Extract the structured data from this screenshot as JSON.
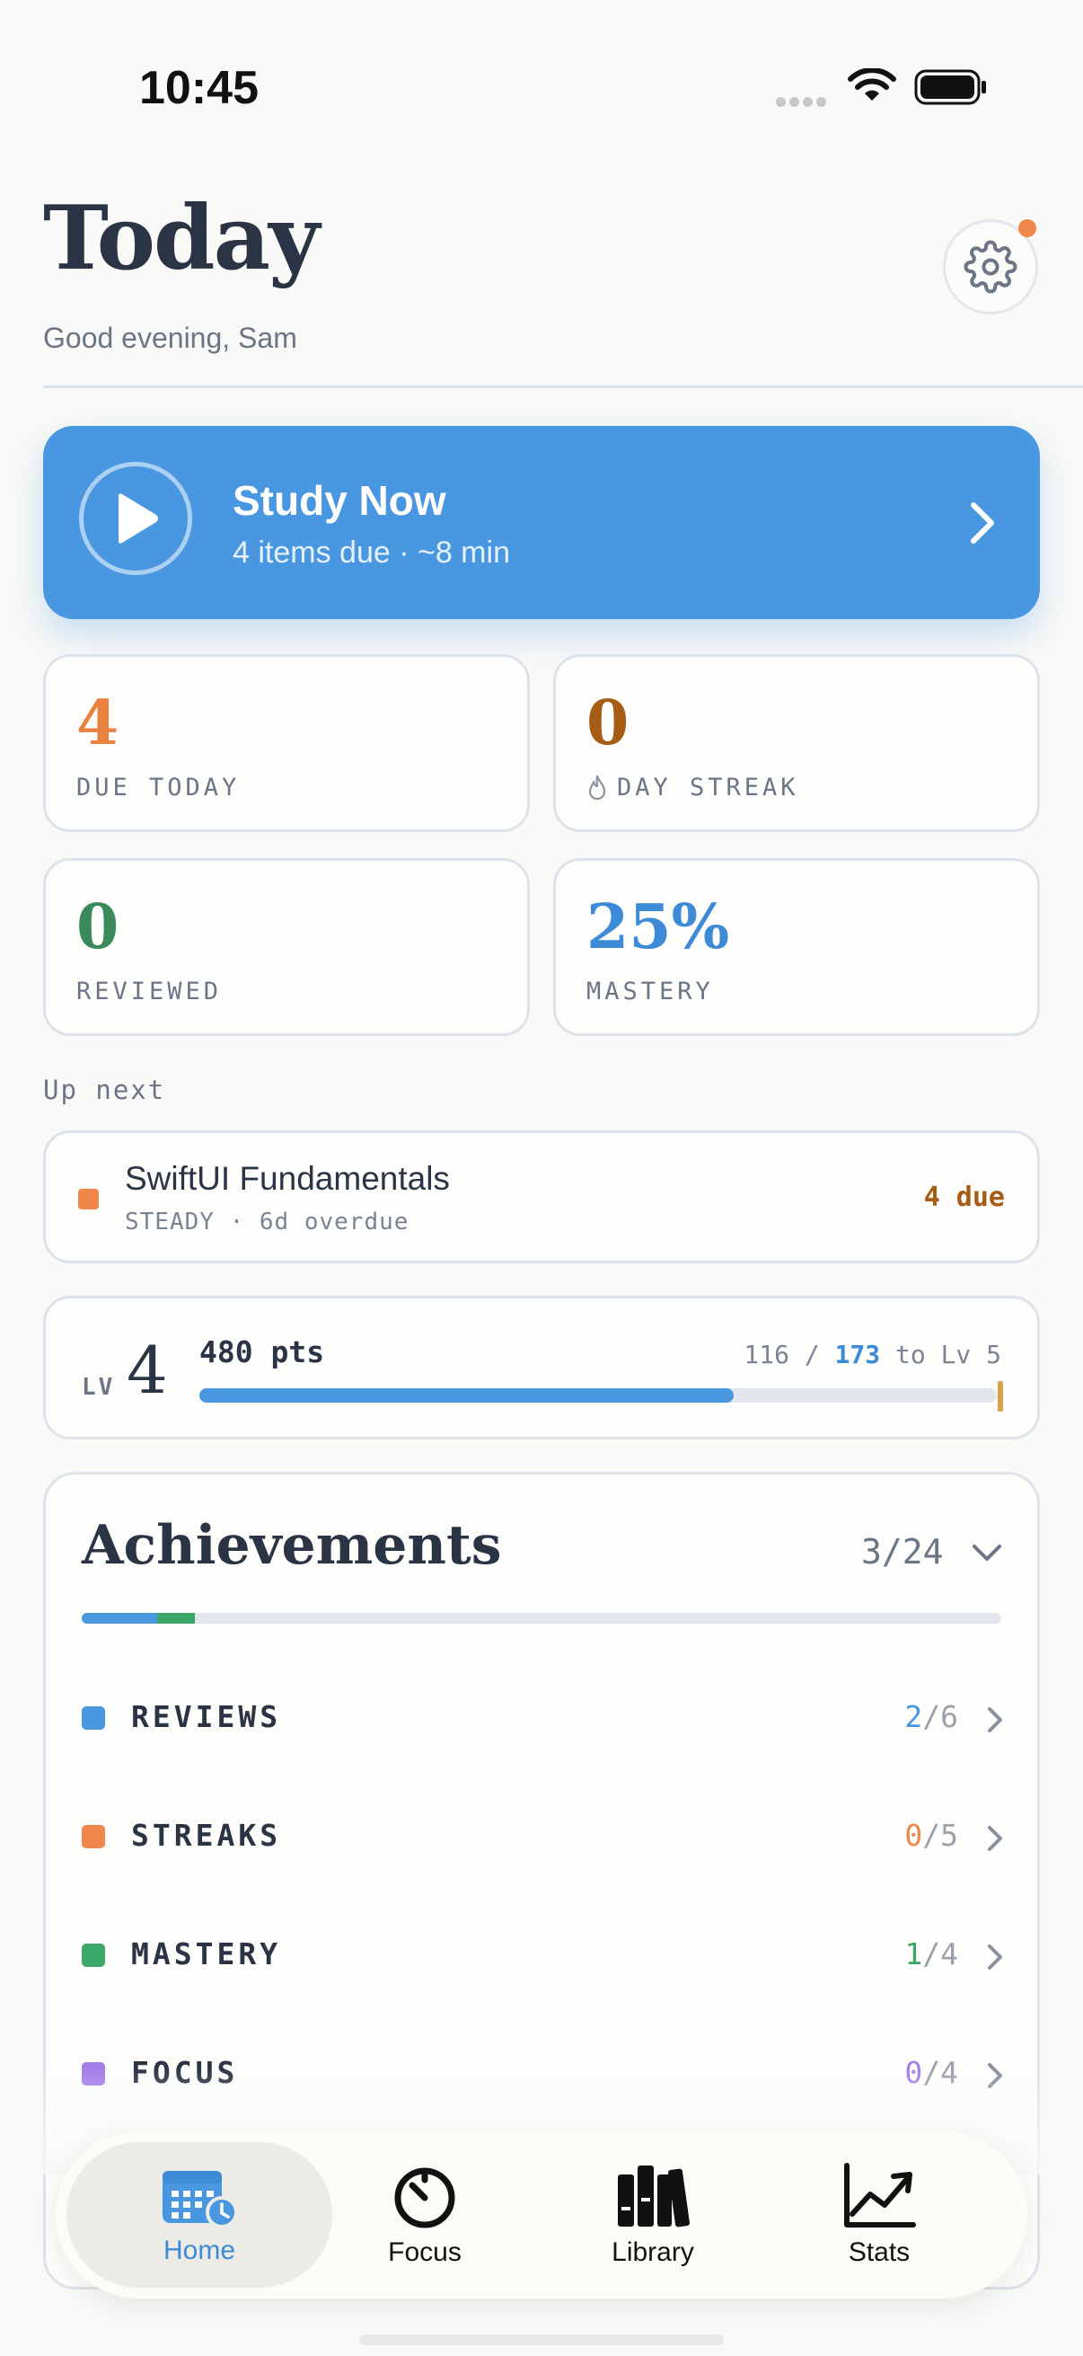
{
  "status_bar": {
    "time": "10:45"
  },
  "header": {
    "title": "Today",
    "greeting": "Good evening, Sam"
  },
  "study_now": {
    "title": "Study Now",
    "subtitle": "4 items due · ~8 min"
  },
  "stats": [
    {
      "value": "4",
      "label": "DUE TODAY",
      "color": "#e8823e"
    },
    {
      "value": "0",
      "label": "DAY STREAK",
      "color": "#a65c14"
    },
    {
      "value": "0",
      "label": "REVIEWED",
      "color": "#3a8a5c"
    },
    {
      "value": "25%",
      "label": "MASTERY",
      "color": "#3d8ad6"
    }
  ],
  "up_next": {
    "section_label": "Up next",
    "deck_title": "SwiftUI Fundamentals",
    "meta": "STEADY · 6d overdue",
    "due": "4 due"
  },
  "level": {
    "tag": "LV",
    "number": "4",
    "points": "480 pts",
    "progress_current": "116",
    "progress_sep": " / ",
    "progress_target": "173",
    "progress_suffix": " to Lv 5",
    "progress_fraction": 0.67
  },
  "achievements": {
    "title": "Achievements",
    "count": "3/24",
    "categories": [
      {
        "name": "REVIEWS",
        "done": "2",
        "total": "/6",
        "color": "#4897e0"
      },
      {
        "name": "STREAKS",
        "done": "0",
        "total": "/5",
        "color": "#f0874a"
      },
      {
        "name": "MASTERY",
        "done": "1",
        "total": "/4",
        "color": "#3aa768"
      },
      {
        "name": "FOCUS",
        "done": "0",
        "total": "/4",
        "color": "#a47de8"
      }
    ]
  },
  "tabs": [
    {
      "label": "Home",
      "icon": "calendar-icon",
      "active": true
    },
    {
      "label": "Focus",
      "icon": "timer-icon",
      "active": false
    },
    {
      "label": "Library",
      "icon": "books-icon",
      "active": false
    },
    {
      "label": "Stats",
      "icon": "chart-icon",
      "active": false
    }
  ]
}
